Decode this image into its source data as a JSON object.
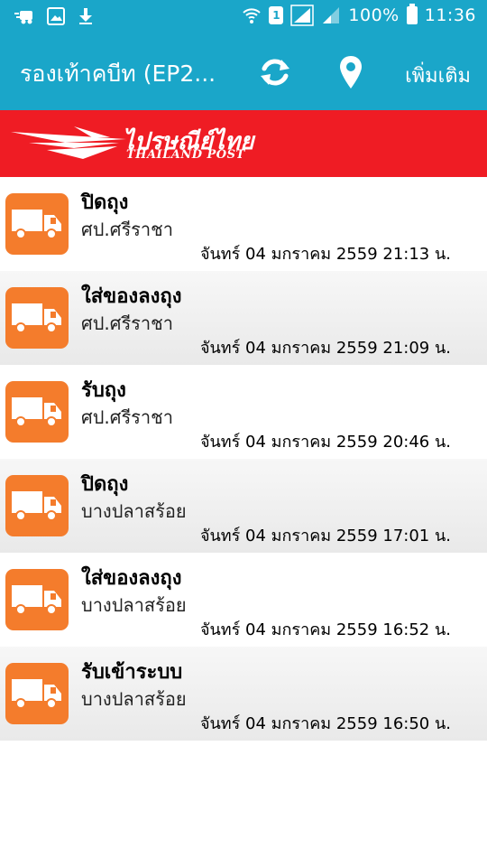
{
  "status_bar": {
    "battery": "100%",
    "time": "11:36",
    "sim_label": "1"
  },
  "action_bar": {
    "title": "รองเท้าคบีท (EP2...",
    "more_label": "เพิ่มเติม",
    "refresh_icon": "refresh-icon",
    "location_icon": "location-pin-icon"
  },
  "banner": {
    "logo_th": "ไปรษณีย์ไทย",
    "logo_en": "THAILAND POST",
    "color": "#ef1c24"
  },
  "colors": {
    "accent": "#1aa6c9",
    "icon_bg": "#f47c2c"
  },
  "tracking": [
    {
      "status": "ปิดถุง",
      "office": "ศป.ศรีราชา",
      "date": "จันทร์ 04 มกราคม 2559 21:13 น."
    },
    {
      "status": "ใส่ของลงถุง",
      "office": "ศป.ศรีราชา",
      "date": "จันทร์ 04 มกราคม 2559 21:09 น."
    },
    {
      "status": "รับถุง",
      "office": "ศป.ศรีราชา",
      "date": "จันทร์ 04 มกราคม 2559 20:46 น."
    },
    {
      "status": "ปิดถุง",
      "office": "บางปลาสร้อย",
      "date": "จันทร์ 04 มกราคม 2559 17:01 น."
    },
    {
      "status": "ใส่ของลงถุง",
      "office": "บางปลาสร้อย",
      "date": "จันทร์ 04 มกราคม 2559 16:52 น."
    },
    {
      "status": "รับเข้าระบบ",
      "office": "บางปลาสร้อย",
      "date": "จันทร์ 04 มกราคม 2559 16:50 น."
    }
  ]
}
